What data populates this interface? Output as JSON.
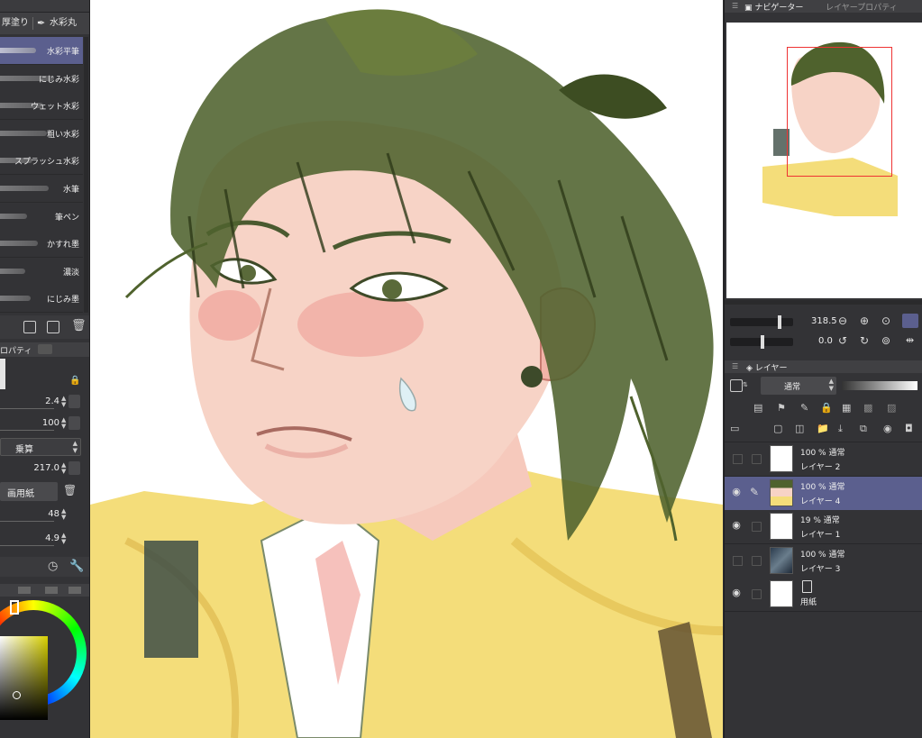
{
  "brush_tabs": [
    "厚塗り",
    "水彩丸"
  ],
  "brushes": [
    {
      "label": "水彩平筆",
      "selected": true
    },
    {
      "label": "にじみ水彩",
      "selected": false
    },
    {
      "label": "ウェット水彩",
      "selected": false
    },
    {
      "label": "粗い水彩",
      "selected": false
    },
    {
      "label": "スプラッシュ水彩",
      "selected": false
    },
    {
      "label": "水筆",
      "selected": false
    },
    {
      "label": "筆ペン",
      "selected": false
    },
    {
      "label": "かすれ墨",
      "selected": false
    },
    {
      "label": "濃淡",
      "selected": false
    },
    {
      "label": "にじみ墨",
      "selected": false
    }
  ],
  "tool_property": {
    "tab_label": "ロパティ",
    "brush_size": "2.4",
    "opacity": "100",
    "blend_mode": "乗算",
    "paper_value": "217.0",
    "paper_label": "画用紙",
    "value_a": "48",
    "value_b": "4.9"
  },
  "navigator": {
    "tab_label": "ナビゲーター",
    "tab_label_2": "レイヤープロパティ",
    "zoom": "318.5",
    "rotation": "0.0"
  },
  "layers_panel": {
    "tab_label": "レイヤー",
    "blend_mode": "通常",
    "layers": [
      {
        "opacity_mode": "100 % 通常",
        "name": "レイヤー 2",
        "visible": false,
        "selected": false,
        "thumb": "checker"
      },
      {
        "opacity_mode": "100 % 通常",
        "name": "レイヤー 4",
        "visible": true,
        "selected": true,
        "thumb": "portrait"
      },
      {
        "opacity_mode": "19 % 通常",
        "name": "レイヤー 1",
        "visible": true,
        "selected": false,
        "thumb": "checker"
      },
      {
        "opacity_mode": "100 % 通常",
        "name": "レイヤー 3",
        "visible": false,
        "selected": false,
        "thumb": "photo"
      },
      {
        "opacity_mode": "",
        "name": "用紙",
        "visible": true,
        "selected": false,
        "thumb": "paper"
      }
    ]
  },
  "colors": {
    "accent": "#5b5f8e",
    "panel": "#333336",
    "skin": "#f6c9bc",
    "hair": "#45562a",
    "jacket": "#f4dd7a"
  }
}
